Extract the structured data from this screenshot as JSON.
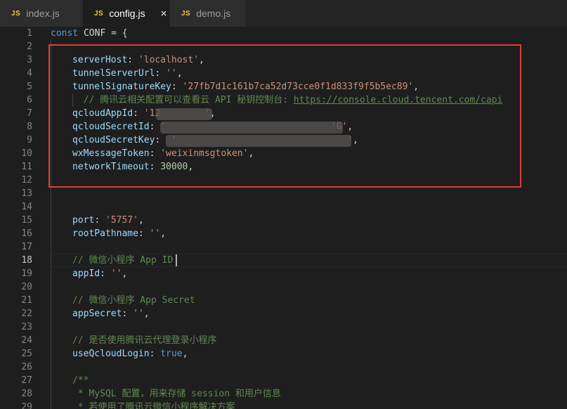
{
  "tabs": [
    {
      "icon": "JS",
      "label": "index.js",
      "active": false
    },
    {
      "icon": "JS",
      "label": "config.js",
      "active": true,
      "close": "×"
    },
    {
      "icon": "JS",
      "label": "demo.js",
      "active": false
    }
  ],
  "editor": {
    "current_line": "18",
    "lines": [
      {
        "n": "1",
        "tokens": [
          [
            "kw",
            "const "
          ],
          [
            "plain",
            "CONF = {"
          ]
        ]
      },
      {
        "n": "2",
        "tokens": []
      },
      {
        "n": "3",
        "tokens": [
          [
            "prop",
            "serverHost"
          ],
          [
            "plain",
            ": "
          ],
          [
            "str",
            "'localhost'"
          ],
          [
            "plain",
            ","
          ]
        ]
      },
      {
        "n": "4",
        "tokens": [
          [
            "prop",
            "tunnelServerUrl"
          ],
          [
            "plain",
            ": "
          ],
          [
            "str",
            "''"
          ],
          [
            "plain",
            ","
          ]
        ]
      },
      {
        "n": "5",
        "tokens": [
          [
            "prop",
            "tunnelSignatureKey"
          ],
          [
            "plain",
            ": "
          ],
          [
            "str",
            "'27fb7d1c161b7ca52d73cce0f1d833f9f5b5ec89'"
          ],
          [
            "plain",
            ","
          ]
        ]
      },
      {
        "n": "6",
        "tokens": [
          [
            "cm",
            "  // 腾讯云相关配置可以查看云 API 秘钥控制台: "
          ],
          [
            "link",
            "https://console.cloud.tencent.com/capi"
          ]
        ]
      },
      {
        "n": "7",
        "tokens": [
          [
            "prop",
            "qcloudAppId"
          ],
          [
            "plain",
            ": "
          ],
          [
            "str",
            "'12"
          ],
          [
            "plain",
            "        "
          ],
          [
            "str",
            "'"
          ],
          [
            "plain",
            ","
          ]
        ]
      },
      {
        "n": "8",
        "tokens": [
          [
            "prop",
            "qcloudSecretId"
          ],
          [
            "plain",
            ": "
          ],
          [
            "str",
            "'                              'G'"
          ],
          [
            "plain",
            ","
          ]
        ]
      },
      {
        "n": "9",
        "tokens": [
          [
            "prop",
            "qcloudSecretKey"
          ],
          [
            "plain",
            ":  "
          ],
          [
            "str",
            "'                               '"
          ],
          [
            "plain",
            ","
          ]
        ]
      },
      {
        "n": "10",
        "tokens": [
          [
            "prop",
            "wxMessageToken"
          ],
          [
            "plain",
            ": "
          ],
          [
            "str",
            "'weixinmsgtoken'"
          ],
          [
            "plain",
            ","
          ]
        ]
      },
      {
        "n": "11",
        "tokens": [
          [
            "prop",
            "networkTimeout"
          ],
          [
            "plain",
            ": "
          ],
          [
            "num",
            "30000"
          ],
          [
            "plain",
            ","
          ]
        ]
      },
      {
        "n": "12",
        "tokens": []
      },
      {
        "n": "13",
        "tokens": []
      },
      {
        "n": "14",
        "tokens": []
      },
      {
        "n": "15",
        "tokens": [
          [
            "prop",
            "port"
          ],
          [
            "plain",
            ": "
          ],
          [
            "str",
            "'5757'"
          ],
          [
            "plain",
            ","
          ]
        ]
      },
      {
        "n": "16",
        "tokens": [
          [
            "prop",
            "rootPathname"
          ],
          [
            "plain",
            ": "
          ],
          [
            "str",
            "''"
          ],
          [
            "plain",
            ","
          ]
        ]
      },
      {
        "n": "17",
        "tokens": []
      },
      {
        "n": "18",
        "tokens": [
          [
            "cm",
            "// 微信小程序 App ID"
          ]
        ]
      },
      {
        "n": "19",
        "tokens": [
          [
            "prop",
            "appId"
          ],
          [
            "plain",
            ": "
          ],
          [
            "str",
            "''"
          ],
          [
            "plain",
            ","
          ]
        ]
      },
      {
        "n": "20",
        "tokens": []
      },
      {
        "n": "21",
        "tokens": [
          [
            "cm",
            "// 微信小程序 App Secret"
          ]
        ]
      },
      {
        "n": "22",
        "tokens": [
          [
            "prop",
            "appSecret"
          ],
          [
            "plain",
            ": "
          ],
          [
            "str",
            "''"
          ],
          [
            "plain",
            ","
          ]
        ]
      },
      {
        "n": "23",
        "tokens": []
      },
      {
        "n": "24",
        "tokens": [
          [
            "cm",
            "// 是否使用腾讯云代理登录小程序"
          ]
        ]
      },
      {
        "n": "25",
        "tokens": [
          [
            "prop",
            "useQcloudLogin"
          ],
          [
            "plain",
            ": "
          ],
          [
            "kw",
            "true"
          ],
          [
            "plain",
            ","
          ]
        ]
      },
      {
        "n": "26",
        "tokens": []
      },
      {
        "n": "27",
        "tokens": [
          [
            "cm",
            "/**"
          ]
        ]
      },
      {
        "n": "28",
        "tokens": [
          [
            "cm",
            " * MySQL 配置，用来存储 session 和用户信息"
          ]
        ]
      },
      {
        "n": "29",
        "tokens": [
          [
            "cm",
            " * 若使用了腾讯云微信小程序解决方案"
          ]
        ]
      }
    ]
  }
}
